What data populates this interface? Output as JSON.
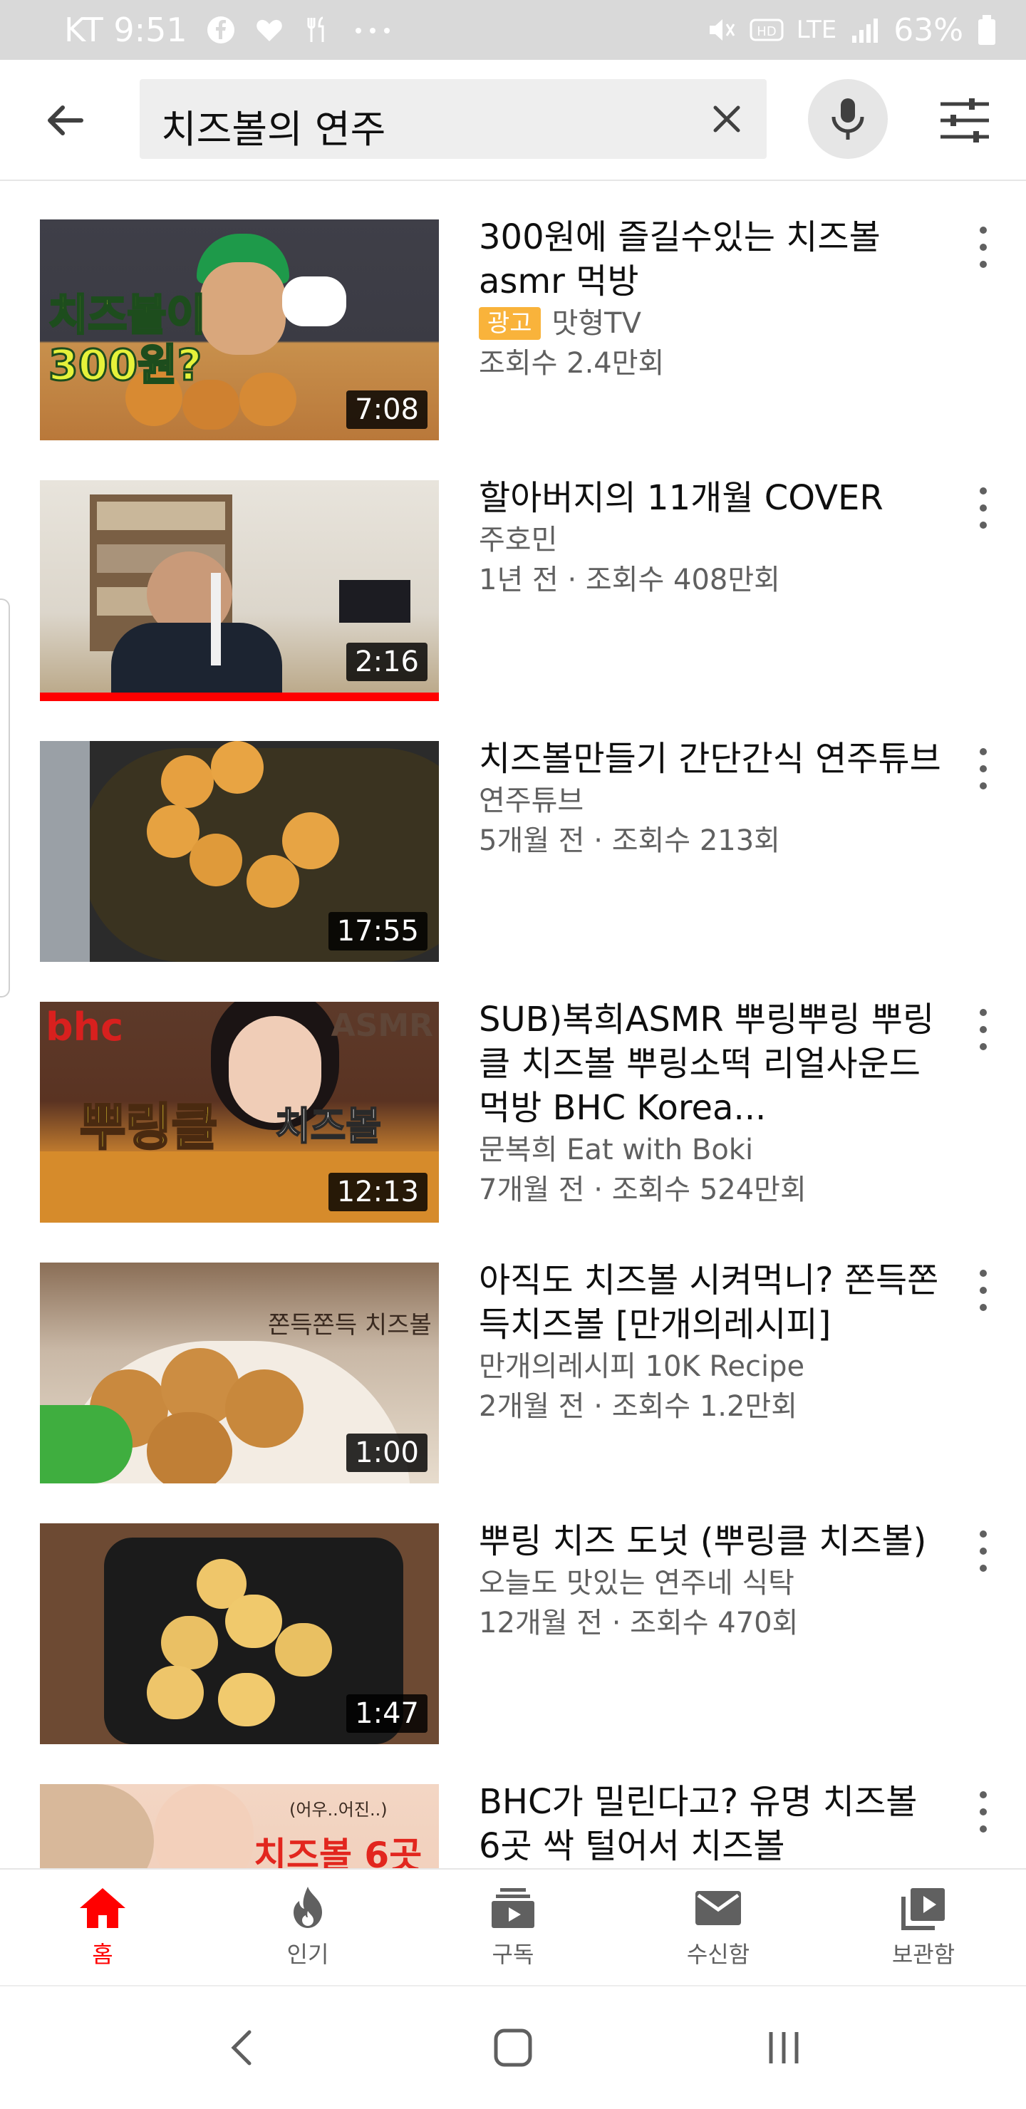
{
  "status_bar": {
    "carrier_time": "KT 9:51",
    "network": "LTE",
    "battery": "63%"
  },
  "search": {
    "query": "치즈볼의 연주"
  },
  "results": [
    {
      "title": "300원에 즐길수있는 치즈볼 asmr 먹방",
      "ad_label": "광고",
      "channel": "맛형TV",
      "meta": "조회수 2.4만회",
      "duration": "7:08",
      "thumb_text": [
        "치즈볼이",
        "300원?"
      ]
    },
    {
      "title": "할아버지의 11개월 COVER",
      "channel": "주호민",
      "meta": "1년 전 · 조회수 408만회",
      "duration": "2:16",
      "progress": 1.0
    },
    {
      "title": "치즈볼만들기 간단간식 연주튜브",
      "channel": "연주튜브",
      "meta": "5개월 전 · 조회수 213회",
      "duration": "17:55"
    },
    {
      "title": "SUB)복희ASMR 뿌링뿌링 뿌링클 치즈볼 뿌링소떡 리얼사운드 먹방 BHC Korea...",
      "channel": "문복희 Eat with Boki",
      "meta": "7개월 전 · 조회수 524만회",
      "duration": "12:13",
      "thumb_text": [
        "bhc",
        "ASMR",
        "뿌링클",
        "치즈볼"
      ]
    },
    {
      "title": "아직도 치즈볼 시켜먹니? 쫀득쫀득치즈볼 [만개의레시피]",
      "channel": "만개의레시피 10K Recipe",
      "meta": "2개월 전 · 조회수 1.2만회",
      "duration": "1:00",
      "thumb_text": [
        "쫀득쫀득 치즈볼"
      ]
    },
    {
      "title": "뿌링 치즈 도넛 (뿌링클 치즈볼)",
      "channel": "오늘도 맛있는 연주네 식탁",
      "meta": "12개월 전 · 조회수 470회",
      "duration": "1:47"
    },
    {
      "title": "BHC가 밀린다고? 유명 치즈볼 6곳 싹 털어서 치즈볼",
      "channel": "",
      "meta": "",
      "duration": "",
      "thumb_text": [
        "(어우..어진..)",
        "치즈볼 6곳"
      ]
    }
  ],
  "bottom_nav": [
    {
      "label": "홈",
      "icon": "home-icon",
      "active": true
    },
    {
      "label": "인기",
      "icon": "flame-icon",
      "active": false
    },
    {
      "label": "구독",
      "icon": "subscriptions-icon",
      "active": false
    },
    {
      "label": "수신함",
      "icon": "inbox-icon",
      "active": false
    },
    {
      "label": "보관함",
      "icon": "library-icon",
      "active": false
    }
  ],
  "colors": {
    "accent": "#ff0000",
    "ad_badge": "#f9b33b",
    "secondary_text": "#606060",
    "status_bar": "#d9d9d9"
  }
}
